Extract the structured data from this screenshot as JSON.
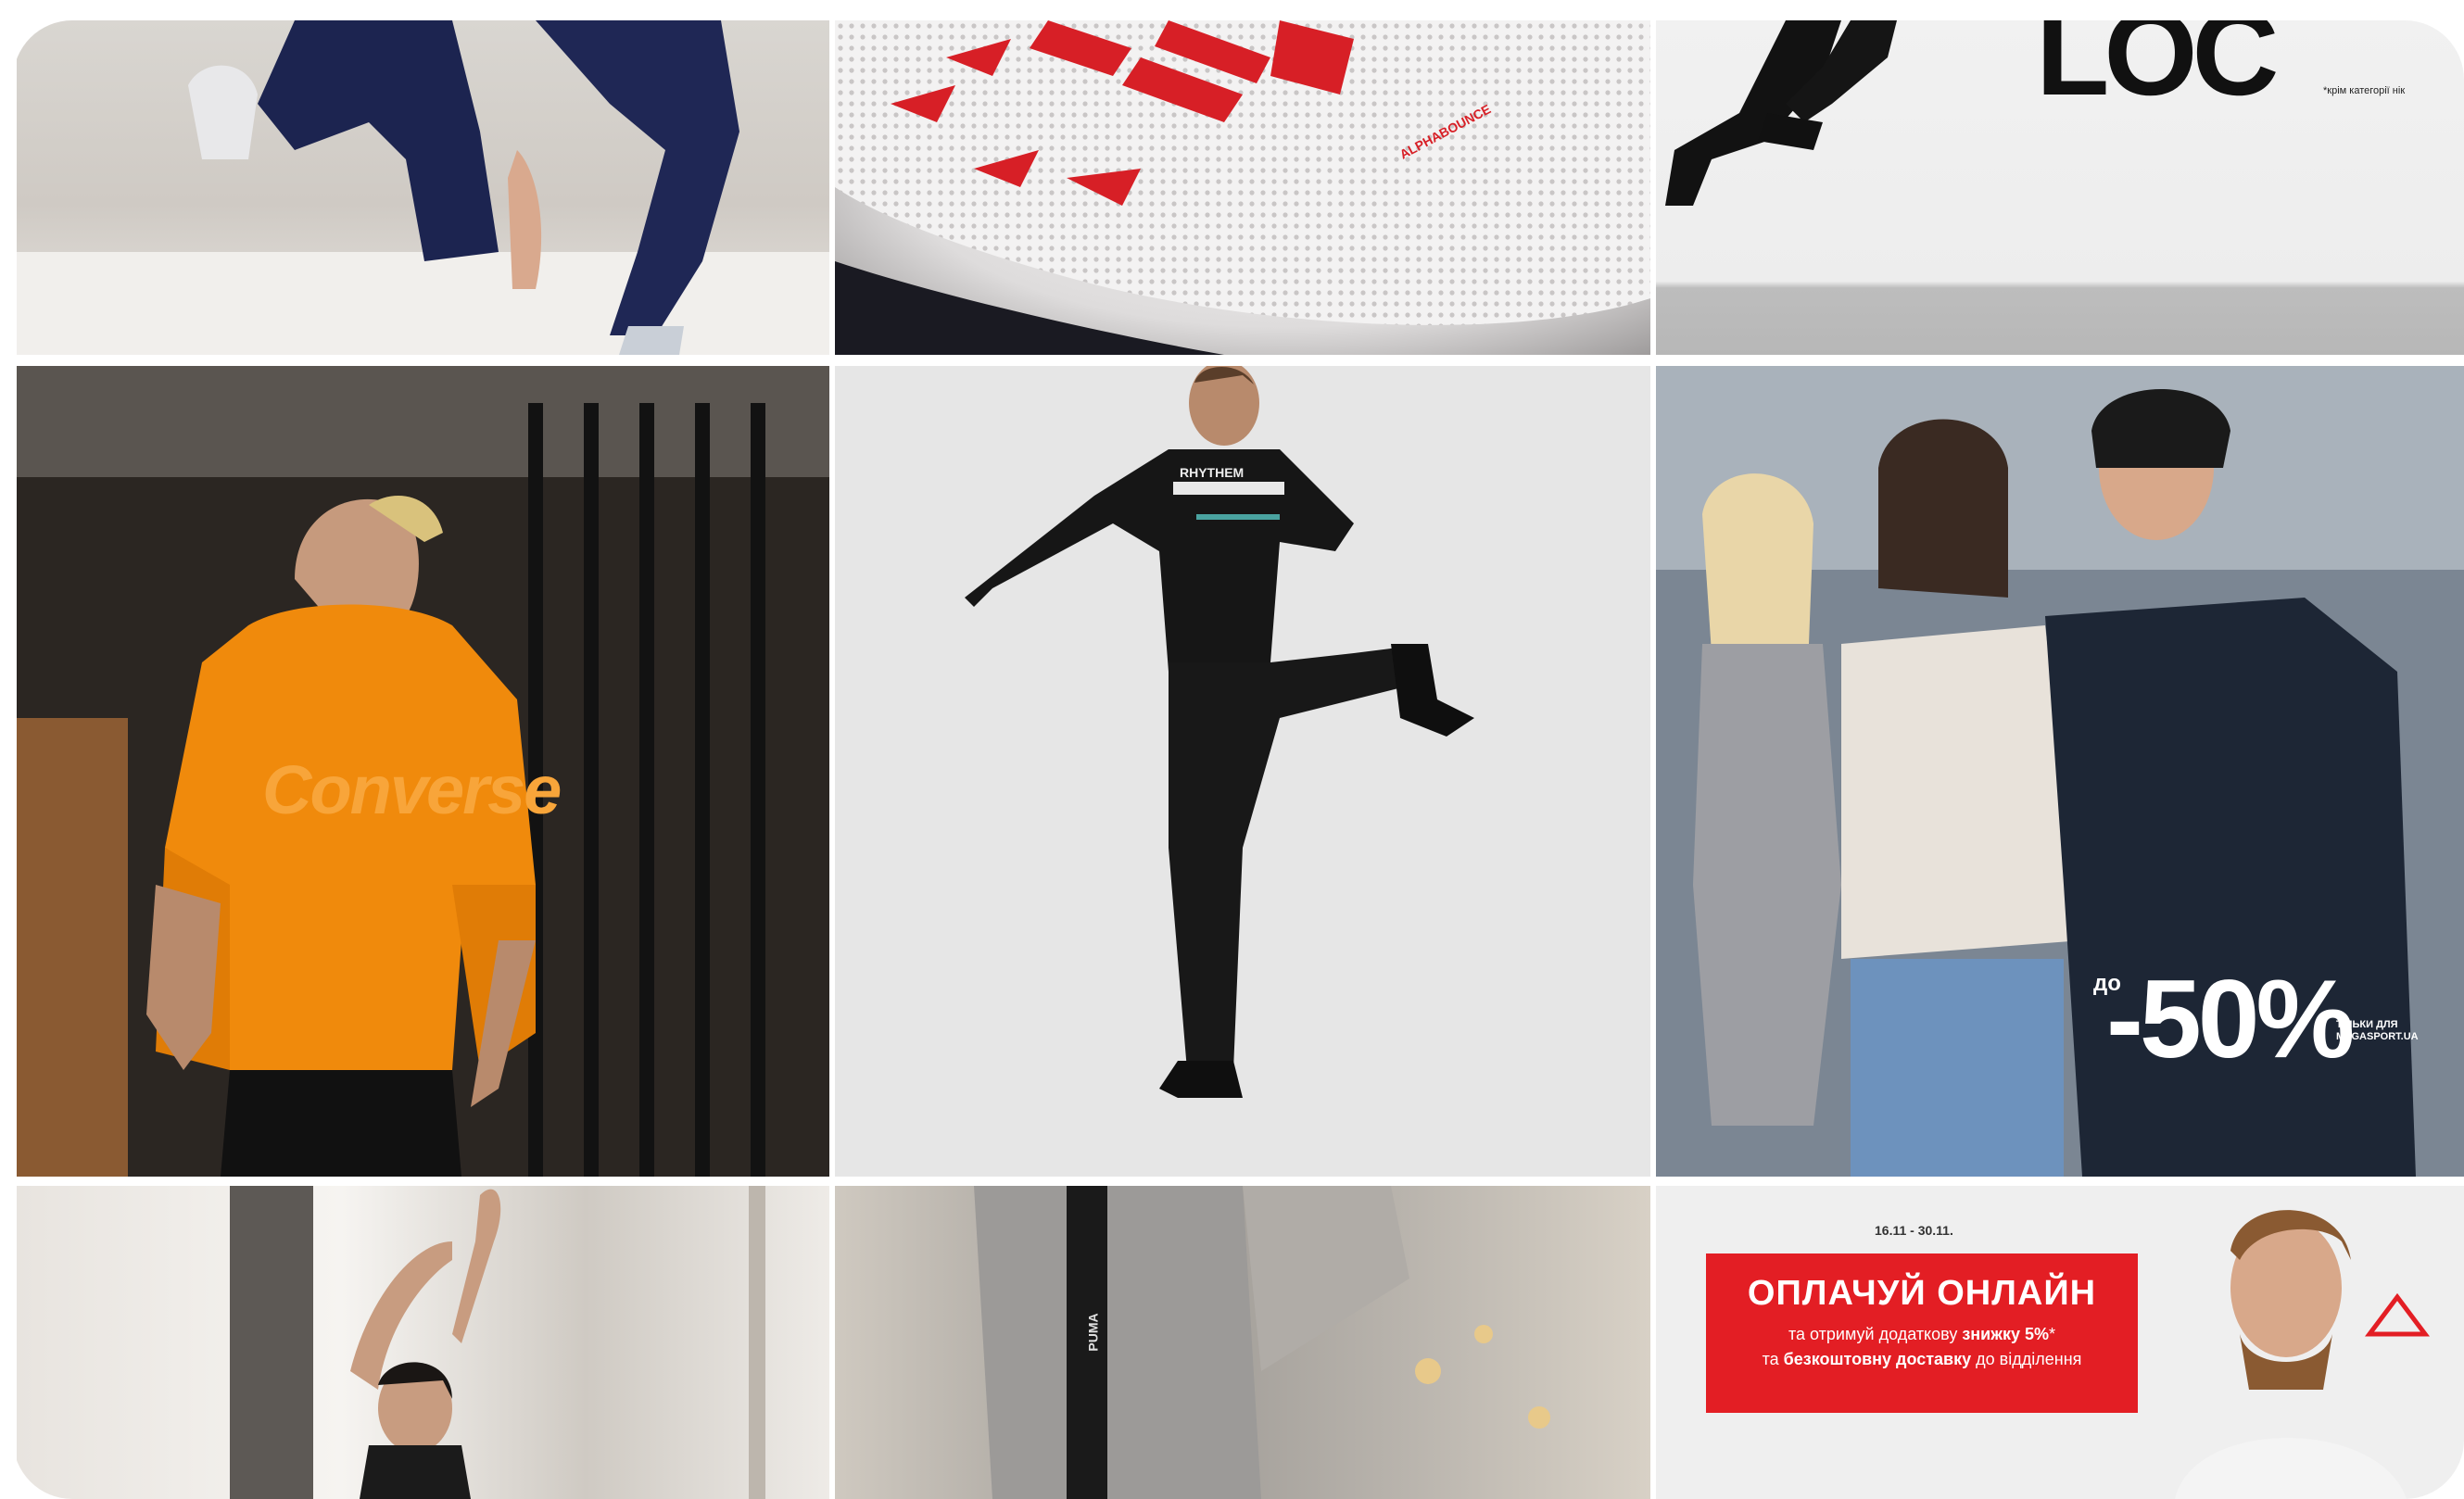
{
  "gallery": {
    "tiles": [
      {
        "name": "tile-athlete-stretch",
        "alt": ""
      },
      {
        "name": "tile-alphabounce-sneaker",
        "brand_text": "ALPHABOUNCE"
      },
      {
        "name": "tile-runner-banner",
        "banner_text": "LOC",
        "note": "*крім категорії нік"
      },
      {
        "name": "tile-converse-hoodie",
        "brand_text": "Converse"
      },
      {
        "name": "tile-jumping-man",
        "shirt_text": "RHYTHEM"
      },
      {
        "name": "tile-winter-sale",
        "sale_prefix": "до",
        "sale_value": "-50%",
        "sale_note": "ТІЛЬКИ ДЛЯ MEGASPORT.UA"
      },
      {
        "name": "tile-yoga-woman"
      },
      {
        "name": "tile-puma-pants",
        "brand_text": "PUMA"
      },
      {
        "name": "tile-pay-online-promo",
        "dates": "16.11 - 30.11.",
        "title": "ОПЛАЧУЙ ОНЛАЙН",
        "line1_a": "та отримуй додаткову ",
        "line1_b": "знижку 5%",
        "line1_c": "*",
        "line2_a": "та ",
        "line2_b": "безкоштовну доставку",
        "line2_c": " до відділення"
      }
    ]
  },
  "colors": {
    "promo_red": "#e31e24",
    "hoodie_orange": "#f08a0c",
    "sneaker_red": "#d71f26"
  }
}
